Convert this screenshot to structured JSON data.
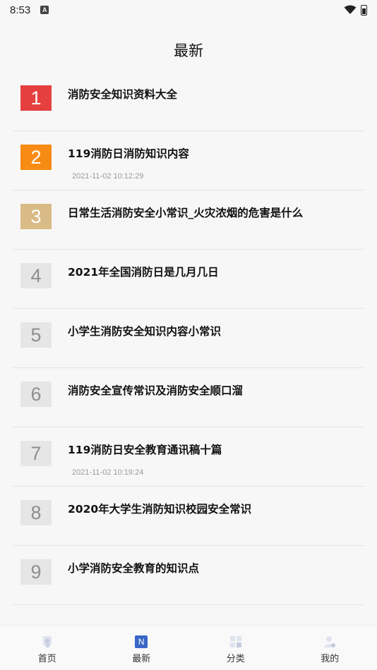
{
  "status_bar": {
    "time": "8:53",
    "app_badge": "A"
  },
  "page": {
    "title": "最新"
  },
  "articles": [
    {
      "rank": "1",
      "title": "消防安全知识资料大全",
      "date": "",
      "rank_color": "#e5403f"
    },
    {
      "rank": "2",
      "title": "119消防日消防知识内容",
      "date": "2021-11-02 10:12:29",
      "rank_color": "#f88b14"
    },
    {
      "rank": "3",
      "title": "日常生活消防安全小常识_火灾浓烟的危害是什么",
      "date": "",
      "rank_color": "#d8bb86"
    },
    {
      "rank": "4",
      "title": "2021年全国消防日是几月几日",
      "date": ""
    },
    {
      "rank": "5",
      "title": "小学生消防安全知识内容小常识",
      "date": ""
    },
    {
      "rank": "6",
      "title": "消防安全宣传常识及消防安全顺口溜",
      "date": ""
    },
    {
      "rank": "7",
      "title": "119消防日安全教育通讯稿十篇",
      "date": "2021-11-02 10:19:24"
    },
    {
      "rank": "8",
      "title": "2020年大学生消防知识校园安全常识",
      "date": ""
    },
    {
      "rank": "9",
      "title": "小学消防安全教育的知识点",
      "date": ""
    }
  ],
  "tabbar": {
    "tabs": [
      {
        "label": "首页",
        "icon": "home-icon"
      },
      {
        "label": "最新",
        "icon": "new-icon",
        "icon_text": "N",
        "active": true
      },
      {
        "label": "分类",
        "icon": "category-icon"
      },
      {
        "label": "我的",
        "icon": "profile-icon"
      }
    ]
  },
  "colors": {
    "accent": "#3a66c7",
    "divider": "#e4e4e4",
    "background": "#f7f7f7"
  }
}
